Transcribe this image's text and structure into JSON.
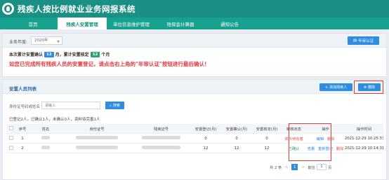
{
  "header": {
    "title": "残疾人按比例就业业务网报系统"
  },
  "nav": {
    "items": [
      {
        "label": "首页"
      },
      {
        "label": "残疾人安置管理"
      },
      {
        "label": "单位信息维护管理"
      },
      {
        "label": "残保金计算器"
      },
      {
        "label": "通知公告"
      }
    ],
    "active": 1
  },
  "summary_panel": {
    "year_label": "业务年度:",
    "year_value": "2020年",
    "annual_button": "年审认证",
    "summary_prefix": "本次累计安置确认",
    "confirmed_count": "12",
    "summary_mid": "月，累计安置核定",
    "approved_count": "12",
    "summary_suffix": "个月",
    "warning": "如您已完成所有残疾人员的安置登记，请点击右上角的\"年审认证\"按钮进行最后确认！"
  },
  "list_panel": {
    "title": "安置人员列表",
    "add_button": "添加残疾人",
    "delete_button": "删除",
    "search_label": "身份证号码或姓名",
    "search_placeholder": "请输入",
    "search_button": "搜索",
    "stats": "已登记2人，已确认1人，未确认0人，资料待完善1人"
  },
  "table": {
    "headers": [
      "序号",
      "姓名",
      "身份证号",
      "残疾证号",
      "安置登记(月)",
      "安置确认(月)",
      "安置核定(月)",
      "审核状态",
      "操作",
      "操作时间"
    ],
    "rows": [
      {
        "no": "1",
        "reg": "0",
        "confirm": "0",
        "approve": "0",
        "status": "资料待完善",
        "status_color": "#e05050",
        "ops": [
          "编辑",
          "删除"
        ],
        "time": "2021-12-29 10:25:33"
      },
      {
        "no": "2",
        "reg": "12",
        "confirm": "12",
        "approve": "12",
        "status": "已确认",
        "status_color": "#2ba36a",
        "ops": [
          "查看",
          "重新登记",
          "删除"
        ],
        "time": "2021-12-29 10:14:31"
      }
    ]
  },
  "pagination": {
    "total": "共 2 条",
    "prev": "<",
    "current": "1",
    "next": ">",
    "goto": "前往",
    "page_input": "1",
    "page_unit": "页"
  },
  "colors": {
    "brand": "#1a8f84",
    "nav": "#17a18f",
    "primary": "#2e8de0",
    "danger": "#e8393f",
    "success": "#2ba36a"
  }
}
